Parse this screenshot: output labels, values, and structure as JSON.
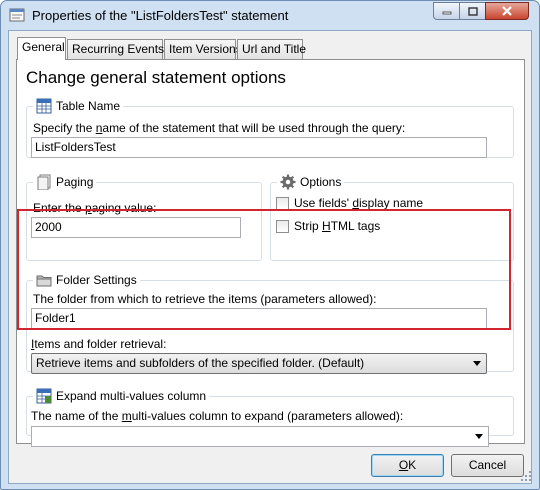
{
  "window": {
    "title": "Properties of the \"ListFoldersTest\" statement",
    "accent": "#d3252f"
  },
  "tabs": [
    {
      "label": "General",
      "selected": true
    },
    {
      "label": "Recurring Events",
      "selected": false
    },
    {
      "label": "Item Versions",
      "selected": false
    },
    {
      "label": "Url and Title",
      "selected": false
    }
  ],
  "page_title": "Change general statement options",
  "table_name": {
    "group": "Table Name",
    "prompt_pre": "Specify the ",
    "prompt_key": "n",
    "prompt_post": "ame of the statement that will be used through the query:",
    "value": "ListFoldersTest"
  },
  "paging": {
    "group": "Paging",
    "prompt_pre": "Enter the ",
    "prompt_key": "p",
    "prompt_post": "aging value:",
    "value": "2000"
  },
  "options": {
    "group": "Options",
    "use_display_name": {
      "label_pre": "Use fields' ",
      "key": "d",
      "label_post": "isplay name",
      "checked": false
    },
    "strip_html": {
      "label_pre": "Strip ",
      "key": "H",
      "label_post": "TML tags",
      "checked": false
    }
  },
  "folder_settings": {
    "group": "Folder Settings",
    "folder_prompt": "The folder from which to retrieve the items (parameters allowed):",
    "folder_value": "Folder1",
    "retrieval_key": "I",
    "retrieval_post": "tems and folder retrieval:",
    "retrieval_value": "Retrieve items and subfolders of the specified folder. (Default)"
  },
  "expand": {
    "group": "Expand multi-values column",
    "prompt_pre": "The name of the ",
    "prompt_key": "m",
    "prompt_post": "ulti-values column to expand (parameters allowed):",
    "value": ""
  },
  "buttons": {
    "ok_key": "O",
    "ok_post": "K",
    "cancel": "Cancel"
  }
}
